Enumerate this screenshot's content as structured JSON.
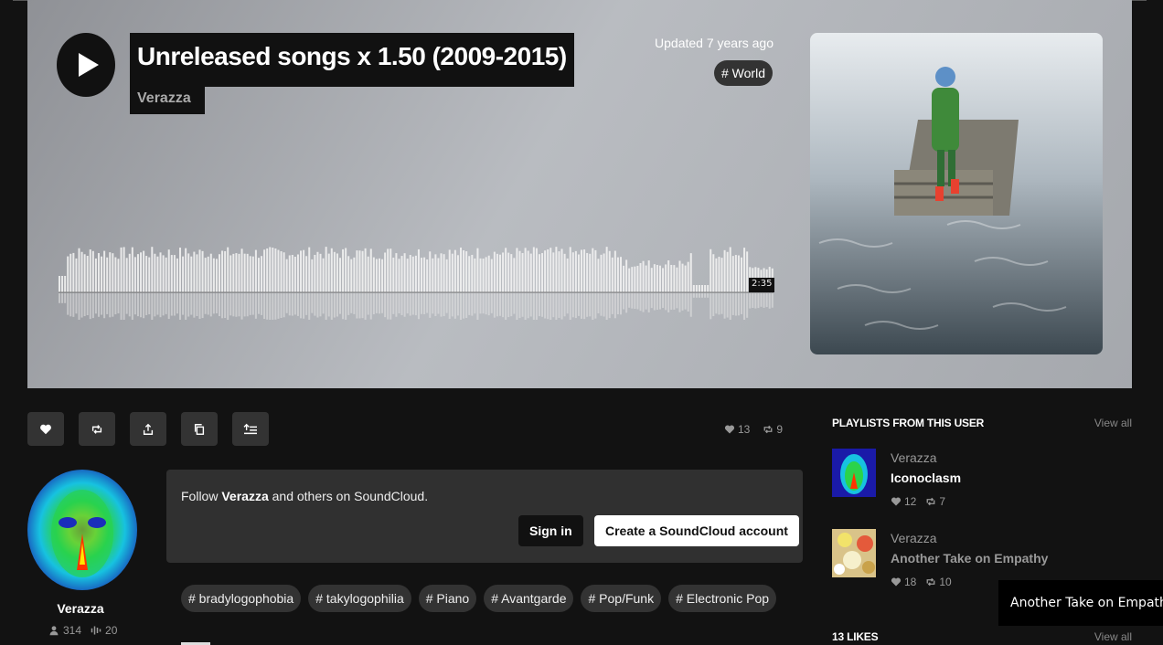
{
  "hero": {
    "title": "Unreleased songs x 1.50 (2009-2015)",
    "artist": "Verazza",
    "updated": "Updated 7 years ago",
    "genre_tag": "# World",
    "duration": "2:35",
    "play_icon": "play-icon"
  },
  "actions": {
    "icons": [
      "heart-icon",
      "repost-icon",
      "share-icon",
      "copy-link-icon",
      "add-to-playlist-icon"
    ]
  },
  "track_stats": {
    "likes": "13",
    "reposts": "9"
  },
  "user": {
    "name": "Verazza",
    "followers": "314",
    "tracks": "20"
  },
  "follow_prompt": {
    "prefix": "Follow ",
    "name": "Verazza",
    "suffix": " and others on SoundCloud.",
    "sign_in": "Sign in",
    "create_account": "Create a SoundCloud account"
  },
  "tags": [
    "# bradylogophobia",
    "# takylogophilia",
    "# Piano",
    "# Avantgarde",
    "# Pop/Funk",
    "# Electronic Pop"
  ],
  "sidebar": {
    "playlists_heading": "PLAYLISTS FROM THIS USER",
    "view_all": "View all",
    "playlists": [
      {
        "artist": "Verazza",
        "title": "Iconoclasm",
        "likes": "12",
        "reposts": "7"
      },
      {
        "artist": "Verazza",
        "title": "Another Take on Empathy",
        "likes": "18",
        "reposts": "10"
      }
    ],
    "likes_heading": "13 LIKES",
    "likes_view_all": "View all"
  },
  "tooltip": "Another Take on Empathy",
  "colors": {
    "hero_bg": "#b9bcc1",
    "panel": "#303030",
    "page_bg": "#121212"
  }
}
